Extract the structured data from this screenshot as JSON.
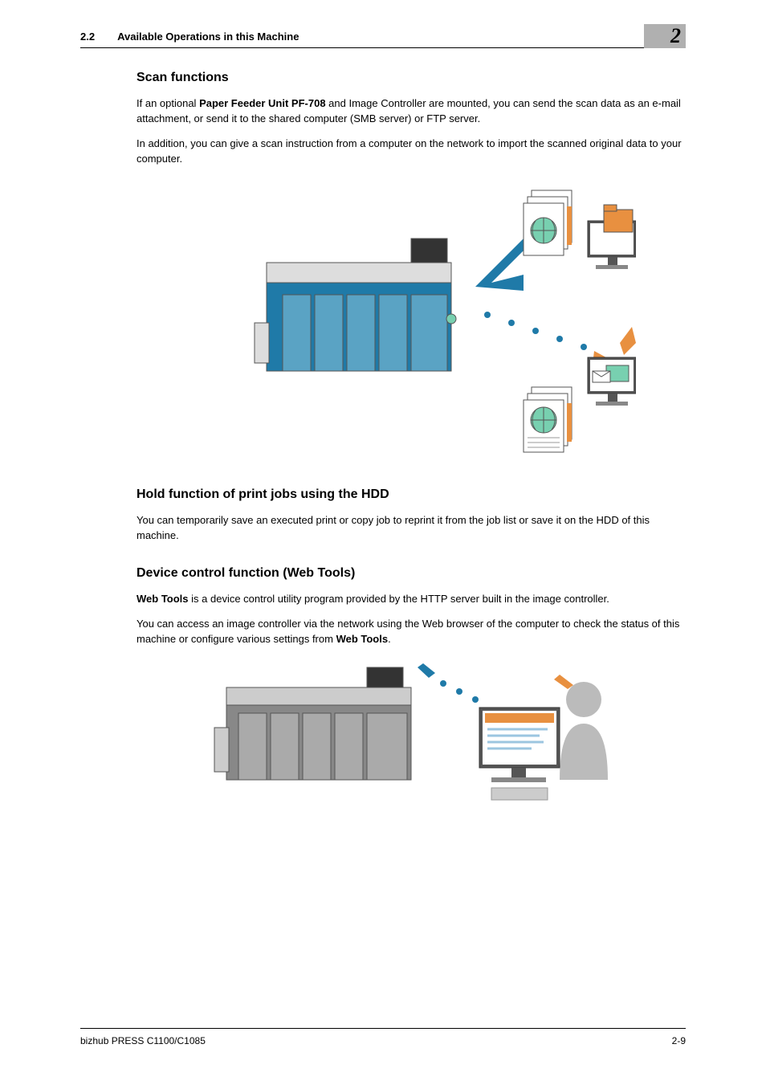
{
  "header": {
    "section_number": "2.2",
    "section_title": "Available Operations in this Machine",
    "chapter_number": "2"
  },
  "sections": {
    "scan": {
      "title": "Scan functions",
      "para1_prefix": "If an optional ",
      "para1_bold": "Paper Feeder Unit PF-708",
      "para1_suffix": " and Image Controller are mounted, you can send the scan data as an e-mail attachment, or send it to the shared computer (SMB server) or FTP server.",
      "para2": "In addition, you can give a scan instruction from a computer on the network to import the scanned original data to your computer."
    },
    "hold": {
      "title": "Hold function of print jobs using the HDD",
      "para1": "You can temporarily save an executed print or copy job to reprint it from the job list or save it on the HDD of this machine."
    },
    "web": {
      "title": "Device control function (Web Tools)",
      "para1_bold": "Web Tools",
      "para1_suffix": " is a device control utility program provided by the HTTP server built in the image controller.",
      "para2_prefix": "You can access an image controller via the network using the Web browser of the computer to check the status of this machine or configure various settings from ",
      "para2_bold": "Web Tools",
      "para2_suffix": "."
    }
  },
  "footer": {
    "product": "bizhub PRESS C1100/C1085",
    "page": "2-9"
  }
}
